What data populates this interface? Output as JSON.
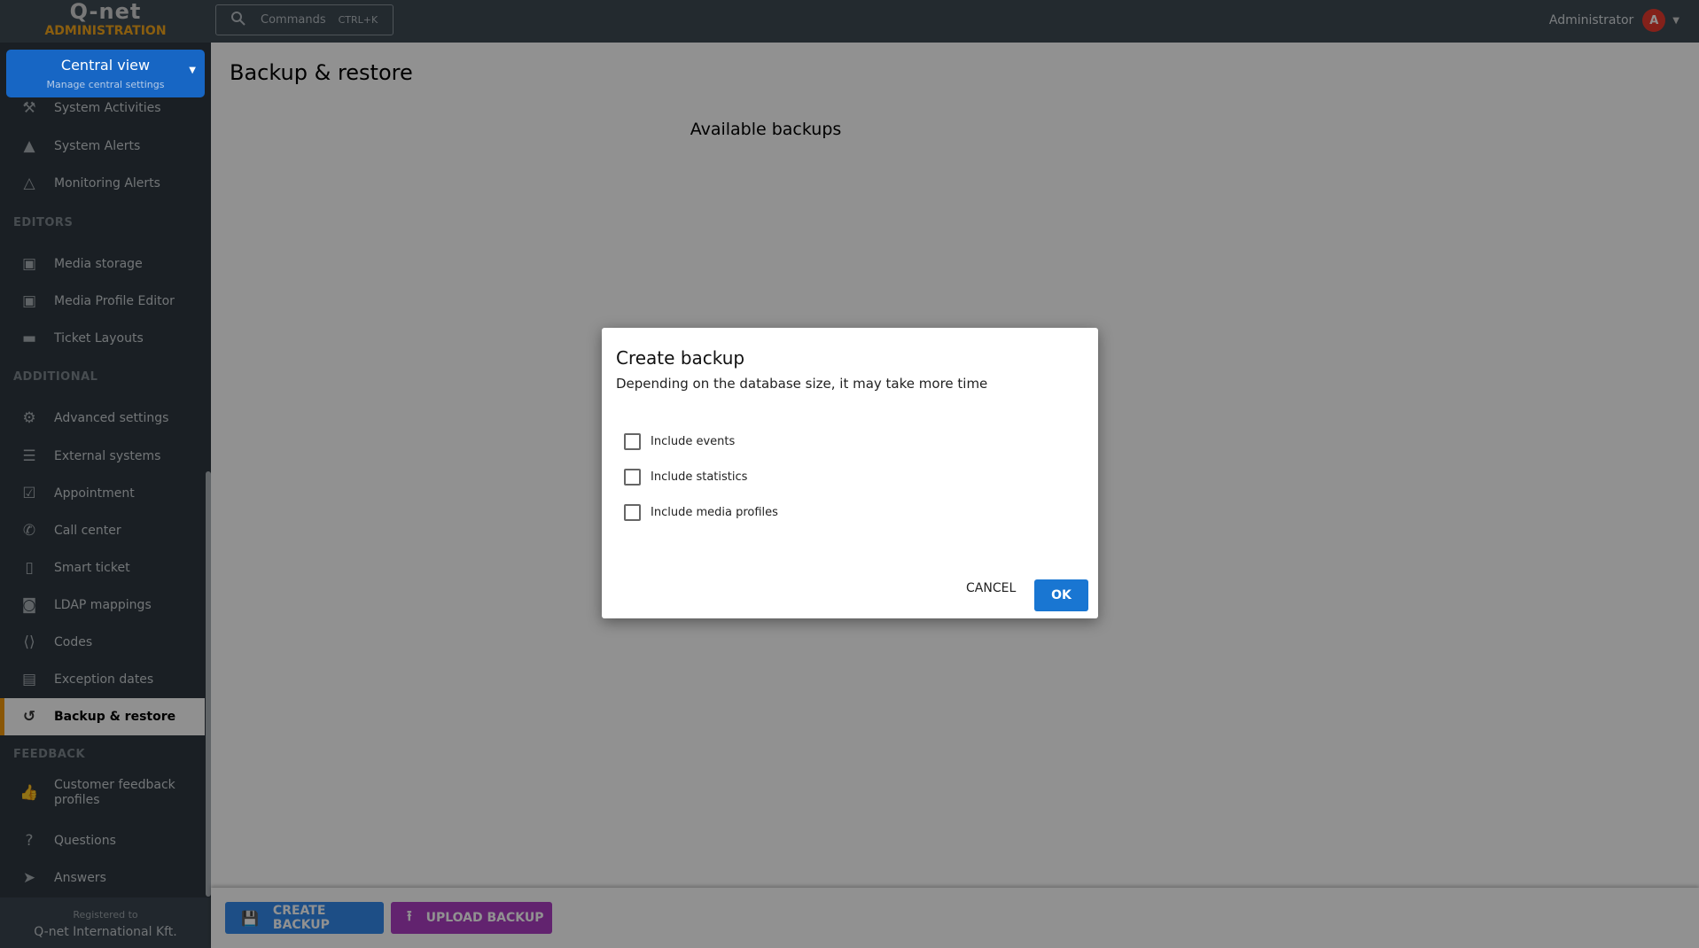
{
  "header": {
    "logo_top": "Q-net",
    "logo_bottom": "ADMINISTRATION",
    "search_placeholder": "Commands",
    "search_shortcut": "CTRL+K",
    "user_name": "Administrator",
    "user_initial": "A"
  },
  "sidebar": {
    "view_title": "Central view",
    "view_subtitle": "Manage central settings",
    "sections": {
      "editors": "EDITORS",
      "additional": "ADDITIONAL",
      "feedback": "FEEDBACK"
    },
    "items": [
      {
        "label": "System Activities",
        "icon": "gavel-icon"
      },
      {
        "label": "System Alerts",
        "icon": "warning-icon"
      },
      {
        "label": "Monitoring Alerts",
        "icon": "warning-outline-icon"
      },
      {
        "label": "Media storage",
        "icon": "photo-library-icon"
      },
      {
        "label": "Media Profile Editor",
        "icon": "perm-media-icon"
      },
      {
        "label": "Ticket Layouts",
        "icon": "ticket-icon"
      },
      {
        "label": "Advanced settings",
        "icon": "settings-icon"
      },
      {
        "label": "External systems",
        "icon": "dns-icon"
      },
      {
        "label": "Appointment",
        "icon": "event-available-icon"
      },
      {
        "label": "Call center",
        "icon": "phone-callback-icon"
      },
      {
        "label": "Smart ticket",
        "icon": "smartphone-icon"
      },
      {
        "label": "LDAP mappings",
        "icon": "badge-icon"
      },
      {
        "label": "Codes",
        "icon": "code-icon"
      },
      {
        "label": "Exception dates",
        "icon": "edit-calendar-icon"
      },
      {
        "label": "Backup & restore",
        "icon": "restore-icon",
        "active": true
      },
      {
        "label": "Customer feedback profiles",
        "icon": "thumb-up-icon"
      },
      {
        "label": "Questions",
        "icon": "help-icon"
      },
      {
        "label": "Answers",
        "icon": "send-icon"
      }
    ],
    "footer_registered": "Registered to",
    "footer_company": "Q-net International Kft."
  },
  "main": {
    "title": "Backup & restore",
    "available_heading": "Available backups",
    "create_button": "CREATE BACKUP",
    "upload_button": "UPLOAD BACKUP"
  },
  "dialog": {
    "title": "Create backup",
    "subtitle": "Depending on the database size, it may take more time",
    "options": [
      {
        "label": "Include events",
        "checked": false
      },
      {
        "label": "Include statistics",
        "checked": false
      },
      {
        "label": "Include media profiles",
        "checked": false
      }
    ],
    "cancel": "CANCEL",
    "ok": "OK"
  },
  "colors": {
    "accent": "#f2a51c",
    "primary": "#1976d2",
    "upload": "#ac3ec3",
    "avatar": "#e83b2e"
  }
}
